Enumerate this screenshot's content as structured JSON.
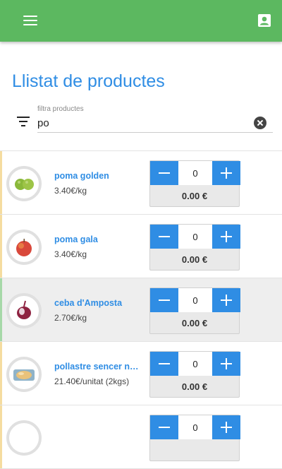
{
  "page": {
    "title": "Llistat de productes"
  },
  "filter": {
    "label": "filtra productes",
    "value": "po"
  },
  "products": [
    {
      "name": "poma golden",
      "price": "3.40€/kg",
      "quantity": "0",
      "total": "0.00 €"
    },
    {
      "name": "poma gala",
      "price": "3.40€/kg",
      "quantity": "0",
      "total": "0.00 €"
    },
    {
      "name": "ceba d'Amposta",
      "price": "2.70€/kg",
      "quantity": "0",
      "total": "0.00 €"
    },
    {
      "name": "pollastre sencer n…",
      "price": "21.40€/unitat (2kgs)",
      "quantity": "0",
      "total": "0.00 €"
    },
    {
      "name": "",
      "price": "",
      "quantity": "0",
      "total": ""
    }
  ],
  "colors": {
    "appbar": "#5cb860",
    "accent": "#2f8de4"
  },
  "icons": {
    "menu": "menu-icon",
    "account": "account-box-icon",
    "filter": "filter-list-icon",
    "clear": "clear-icon"
  }
}
